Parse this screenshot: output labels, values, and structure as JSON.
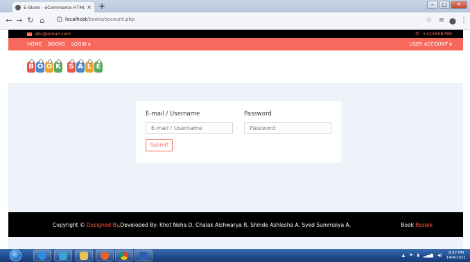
{
  "browser": {
    "tab_title": "E-Store - eCommerce HTML Tem",
    "tab_close": "×",
    "new_tab": "+",
    "url_host": "localhost",
    "url_path": "/books/account.php",
    "window_controls": [
      "–",
      "□",
      "✕"
    ]
  },
  "topbar": {
    "email": "abc@email.com",
    "phone": "+123456789"
  },
  "navbar": {
    "items": [
      "HOME",
      "BOOKS",
      "LOGIN"
    ],
    "user_account": "USER ACCOUNT"
  },
  "logo": {
    "word1": [
      "B",
      "O",
      "O",
      "K"
    ],
    "word2": [
      "S",
      "A",
      "L",
      "E"
    ],
    "tile_colors": [
      "#e9574b",
      "#4a86c8",
      "#f0a030",
      "#5aa95a"
    ]
  },
  "login": {
    "email_label": "E-mail / Username",
    "email_placeholder": "E-mail / Username",
    "password_label": "Password",
    "password_placeholder": "Password",
    "submit_label": "Submit"
  },
  "footer": {
    "copyright_prefix": "Copyright ©",
    "designed_by": "Designed By",
    "developers": ".Developed By: Khot Neha D, Chalak Aishwarya R, Shinde Ashlesha A, Syed Summaiya A.",
    "brand_book": "Book",
    "brand_resale": "Resale"
  },
  "taskbar": {
    "time": "9:37 PM",
    "date": "14/4/2021"
  },
  "colors": {
    "accent": "#f7695c",
    "topbar_bg": "#000000",
    "main_bg": "#eef3f9"
  }
}
